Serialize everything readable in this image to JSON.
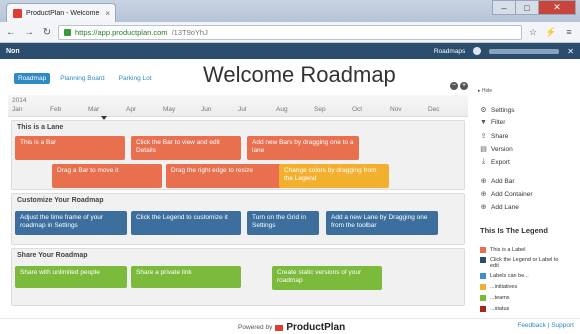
{
  "browser": {
    "tab_title": "ProductPlan - Welcome R",
    "tab_close": "×",
    "url_host": "https://app.productplan.com",
    "url_path": "/13T9oYhJ",
    "back": "←",
    "forward": "→",
    "reload": "↻",
    "star": "☆",
    "menu": "≡"
  },
  "appbar": {
    "product_name": "Non",
    "roadmaps_label": "Roadmaps",
    "close": "✕"
  },
  "board": {
    "title": "Welcome Roadmap",
    "view_tabs": [
      "Roadmap",
      "Planning Board",
      "Parking Lot"
    ],
    "zoom_in": "+",
    "zoom_out": "−",
    "year": "2014",
    "months": [
      "Jan",
      "Feb",
      "Mar",
      "Apr",
      "May",
      "Jun",
      "Jul",
      "Aug",
      "Sep",
      "Oct",
      "Nov",
      "Dec"
    ]
  },
  "lanes": [
    {
      "title": "This is a Lane",
      "bars": [
        {
          "label": "This is a Bar",
          "color": "#e8704f"
        },
        {
          "label": "Click the Bar to view and edit Details",
          "color": "#e8704f"
        },
        {
          "label": "Add new Bars by dragging one to a lane",
          "color": "#e8704f"
        },
        {
          "label": "Drag a Bar to move it",
          "color": "#e8704f"
        },
        {
          "label": "Drag the right edge to resize",
          "color": "#e8704f"
        },
        {
          "label": "Change colors by dragging from the Legend",
          "color": "#f2b02e"
        }
      ]
    },
    {
      "title": "Customize Your Roadmap",
      "bars": [
        {
          "label": "Adjust the time frame of your roadmap in Settings",
          "color": "#3c6e9e"
        },
        {
          "label": "Click the Legend to customize it",
          "color": "#3c6e9e"
        },
        {
          "label": "Turn on the Grid in Settings",
          "color": "#3c6e9e"
        },
        {
          "label": "Add a new Lane by Dragging one from the toolbar",
          "color": "#3c6e9e"
        }
      ]
    },
    {
      "title": "Share Your Roadmap",
      "bars": [
        {
          "label": "Share with unlimited people",
          "color": "#7cba3c"
        },
        {
          "label": "Share a private link",
          "color": "#7cba3c"
        },
        {
          "label": "Create static versions of your roadmap",
          "color": "#7cba3c"
        }
      ]
    }
  ],
  "sidebar": {
    "hide": "Hide",
    "items": [
      {
        "icon": "⚙",
        "label": "Settings"
      },
      {
        "icon": "▼",
        "label": "Filter"
      },
      {
        "icon": "⇪",
        "label": "Share"
      },
      {
        "icon": "▤",
        "label": "Version"
      },
      {
        "icon": "⤓",
        "label": "Export"
      },
      {
        "icon": "⊕",
        "label": "Add Bar"
      },
      {
        "icon": "⊕",
        "label": "Add Container"
      },
      {
        "icon": "⊕",
        "label": "Add Lane"
      }
    ],
    "legend_title": "This Is The Legend",
    "legend": [
      {
        "label": "This is a Label",
        "color": "#e8704f"
      },
      {
        "label": "Click the Legend or Label to edit",
        "color": "#2b4d6e"
      },
      {
        "label": "Labels can be...",
        "color": "#3c8fd1"
      },
      {
        "label": "...initiatives",
        "color": "#f2b02e"
      },
      {
        "label": "...teams",
        "color": "#7cba3c"
      },
      {
        "label": "...status",
        "color": "#a8241f"
      }
    ]
  },
  "footer": {
    "powered_by": "Powered by",
    "brand": "ProductPlan",
    "feedback": "Feedback",
    "separator": "|",
    "support": "Support"
  }
}
